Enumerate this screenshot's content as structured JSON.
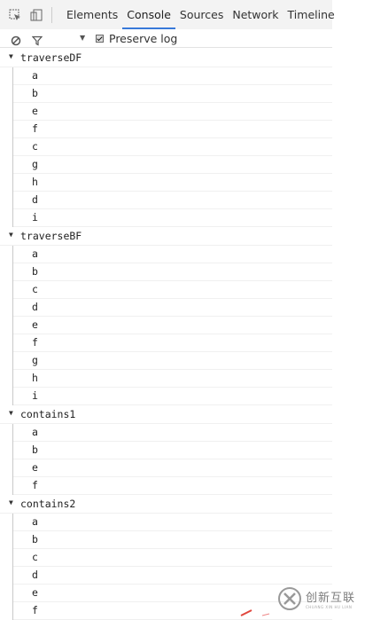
{
  "toolbar": {
    "tabs": [
      "Elements",
      "Console",
      "Sources",
      "Network",
      "Timeline"
    ],
    "active_tab": "Console",
    "icons": [
      "inspect-icon",
      "device-mode-icon"
    ]
  },
  "filterbar": {
    "preserve_log_label": "Preserve log",
    "preserve_log_checked": true
  },
  "console": {
    "groups": [
      {
        "name": "traverseDF",
        "expanded": true,
        "lines": [
          "a",
          "b",
          "e",
          "f",
          "c",
          "g",
          "h",
          "d",
          "i"
        ]
      },
      {
        "name": "traverseBF",
        "expanded": true,
        "lines": [
          "a",
          "b",
          "c",
          "d",
          "e",
          "f",
          "g",
          "h",
          "i"
        ]
      },
      {
        "name": "contains1",
        "expanded": true,
        "lines": [
          "a",
          "b",
          "e",
          "f"
        ]
      },
      {
        "name": "contains2",
        "expanded": true,
        "lines": [
          "a",
          "b",
          "c",
          "d",
          "e",
          "f"
        ]
      }
    ]
  },
  "watermark": {
    "title": "创新互联",
    "subtitle": "CHUANG XIN HU LIAN"
  },
  "colors": {
    "active_tab_underline": "#3879d9",
    "toolbar_bg": "#f3f3f3",
    "group_rule": "#c9c9c9"
  }
}
